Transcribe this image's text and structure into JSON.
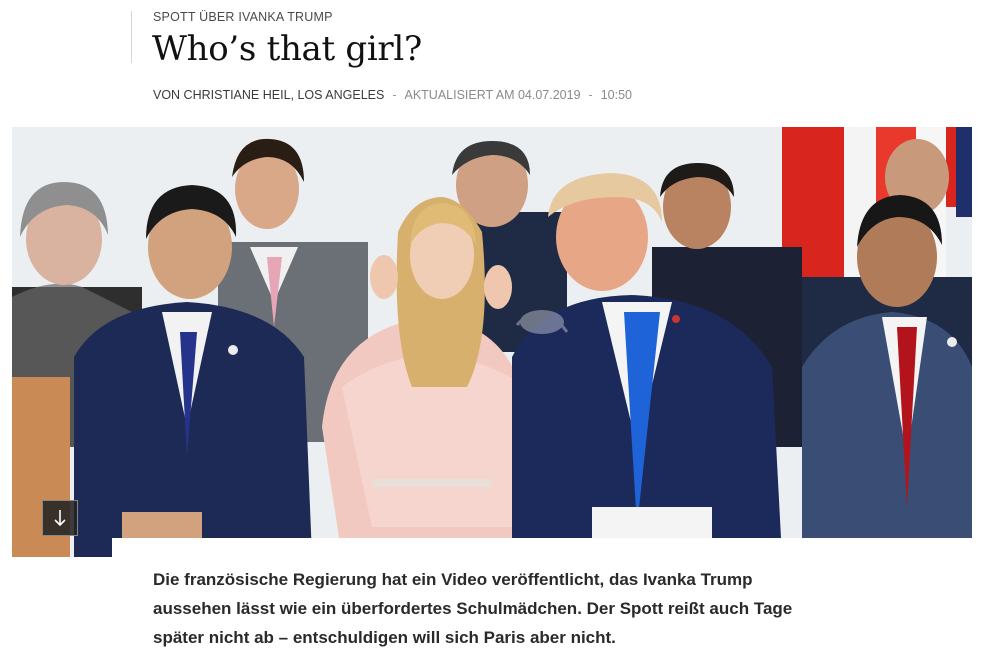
{
  "article": {
    "kicker": "SPOTT ÜBER IVANKA TRUMP",
    "headline": "Who’s that girl?",
    "byline": {
      "author": "VON CHRISTIANE HEIL, LOS ANGELES",
      "updated_label": "AKTUALISIERT AM 04.07.2019",
      "time": "10:50",
      "separator": "-"
    },
    "lead": "Die französische Regierung hat ein Video veröffentlicht, das Ivanka Trump aussehen lässt wie ein überfordertes Schulmädchen. Der Spott reißt auch Tage später nicht ab – entschuldigen will sich Paris aber nicht."
  },
  "hero_image": {
    "icon": "scroll-down-arrow-icon"
  },
  "colors": {
    "text": "#111111",
    "muted": "#8a8a8a",
    "button_bg": "#232323"
  }
}
